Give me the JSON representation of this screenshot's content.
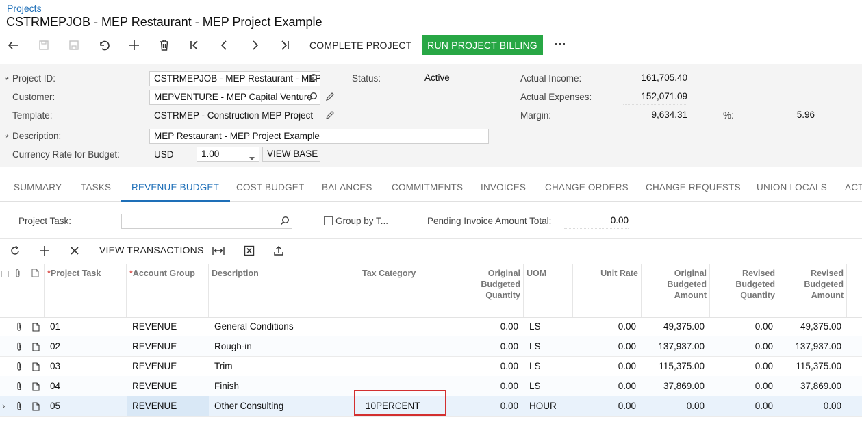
{
  "breadcrumb": "Projects",
  "page_title": "CSTRMEPJOB - MEP Restaurant - MEP Project Example",
  "toolbar": {
    "complete_project": "COMPLETE PROJECT",
    "run_project_billing": "RUN PROJECT BILLING",
    "more": "⋯"
  },
  "form": {
    "project_id_label": "Project ID:",
    "project_id_value": "CSTRMEPJOB - MEP Restaurant - MEP",
    "customer_label": "Customer:",
    "customer_value": "MEPVENTURE - MEP Capital Venture",
    "template_label": "Template:",
    "template_value": "CSTRMEP - Construction MEP Project",
    "description_label": "Description:",
    "description_value": "MEP Restaurant - MEP Project Example",
    "currency_label": "Currency Rate for Budget:",
    "currency_value": "USD",
    "rate_value": "1.00",
    "view_base": "VIEW BASE",
    "status_label": "Status:",
    "status_value": "Active",
    "actual_income_label": "Actual Income:",
    "actual_income_value": "161,705.40",
    "actual_expenses_label": "Actual Expenses:",
    "actual_expenses_value": "152,071.09",
    "margin_label": "Margin:",
    "margin_value": "9,634.31",
    "percent_label": "%:",
    "percent_value": "5.96",
    "required_mark": "*"
  },
  "tabs": [
    "SUMMARY",
    "TASKS",
    "REVENUE BUDGET",
    "COST BUDGET",
    "BALANCES",
    "COMMITMENTS",
    "INVOICES",
    "CHANGE ORDERS",
    "CHANGE REQUESTS",
    "UNION LOCALS",
    "ACT"
  ],
  "active_tab": "REVENUE BUDGET",
  "filter": {
    "project_task_label": "Project Task:",
    "project_task_value": "",
    "group_by_label": "Group by T...",
    "pending_label": "Pending Invoice Amount Total:",
    "pending_value": "0.00"
  },
  "grid_toolbar": {
    "view_transactions": "VIEW TRANSACTIONS"
  },
  "columns": {
    "project_task": "Project Task",
    "account_group": "Account Group",
    "description": "Description",
    "tax_category": "Tax Category",
    "orig_qty_1": "Original",
    "orig_qty_2": "Budgeted",
    "orig_qty_3": "Quantity",
    "uom": "UOM",
    "unit_rate": "Unit Rate",
    "orig_amt_1": "Original",
    "orig_amt_2": "Budgeted",
    "orig_amt_3": "Amount",
    "rev_qty_1": "Revised",
    "rev_qty_2": "Budgeted",
    "rev_qty_3": "Quantity",
    "rev_amt_1": "Revised",
    "rev_amt_2": "Budgeted",
    "rev_amt_3": "Amount",
    "required_mark": "*"
  },
  "rows": [
    {
      "task": "01",
      "account_group": "REVENUE",
      "description": "General Conditions",
      "tax_category": "",
      "orig_qty": "0.00",
      "uom": "LS",
      "unit_rate": "0.00",
      "orig_amt": "49,375.00",
      "rev_qty": "0.00",
      "rev_amt": "49,375.00"
    },
    {
      "task": "02",
      "account_group": "REVENUE",
      "description": "Rough-in",
      "tax_category": "",
      "orig_qty": "0.00",
      "uom": "LS",
      "unit_rate": "0.00",
      "orig_amt": "137,937.00",
      "rev_qty": "0.00",
      "rev_amt": "137,937.00"
    },
    {
      "task": "03",
      "account_group": "REVENUE",
      "description": "Trim",
      "tax_category": "",
      "orig_qty": "0.00",
      "uom": "LS",
      "unit_rate": "0.00",
      "orig_amt": "115,375.00",
      "rev_qty": "0.00",
      "rev_amt": "115,375.00"
    },
    {
      "task": "04",
      "account_group": "REVENUE",
      "description": "Finish",
      "tax_category": "",
      "orig_qty": "0.00",
      "uom": "LS",
      "unit_rate": "0.00",
      "orig_amt": "37,869.00",
      "rev_qty": "0.00",
      "rev_amt": "37,869.00"
    },
    {
      "task": "05",
      "account_group": "REVENUE",
      "description": "Other Consulting",
      "tax_category": "10PERCENT",
      "orig_qty": "0.00",
      "uom": "HOUR",
      "unit_rate": "0.00",
      "orig_amt": "0.00",
      "rev_qty": "0.00",
      "rev_amt": "0.00"
    }
  ],
  "colors": {
    "accent": "#1e6fb8",
    "green_button": "#28a745",
    "highlight_box": "#d32f2f",
    "selected_row": "#e9f2fb"
  }
}
